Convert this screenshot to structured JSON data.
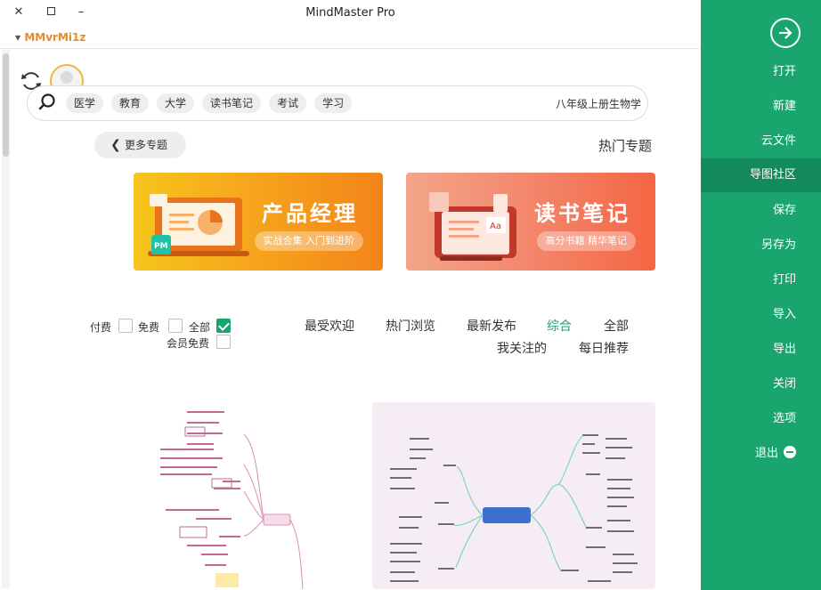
{
  "window": {
    "title": "MindMaster Pro",
    "minimize_label": "–",
    "close_label": "✕",
    "user_name": "MMvrMi1z"
  },
  "search": {
    "query": "八年级上册生物学",
    "tags": [
      "学习",
      "考试",
      "读书笔记",
      "大学",
      "教育",
      "医学"
    ]
  },
  "hot_topics": {
    "title": "热门专题",
    "more_label": "更多专题"
  },
  "banners": [
    {
      "title": "读书笔记",
      "subtitle": "高分书籍 精华笔记"
    },
    {
      "title": "产品经理",
      "subtitle": "实战合集 入门到进阶"
    }
  ],
  "filters": {
    "row1": [
      "全部",
      "综合",
      "最新发布",
      "热门浏览",
      "最受欢迎"
    ],
    "row2": [
      "每日推荐",
      "我关注的"
    ],
    "active": "综合"
  },
  "price_filters": {
    "all": "全部",
    "free": "免费",
    "paid": "付费",
    "member_free": "会员免费"
  },
  "sidebar": {
    "items": [
      "打开",
      "新建",
      "云文件",
      "导图社区",
      "保存",
      "另存为",
      "打印",
      "导入",
      "导出",
      "关闭",
      "选项",
      "退出"
    ],
    "active": "导图社区"
  },
  "colors": {
    "sidebar": "#1aa56e",
    "sidebar_active": "#138a5b",
    "accent_text": "#1aa56e",
    "banner_product": "#f6a01c",
    "banner_reading": "#f3866b",
    "user_name": "#e8892a"
  }
}
